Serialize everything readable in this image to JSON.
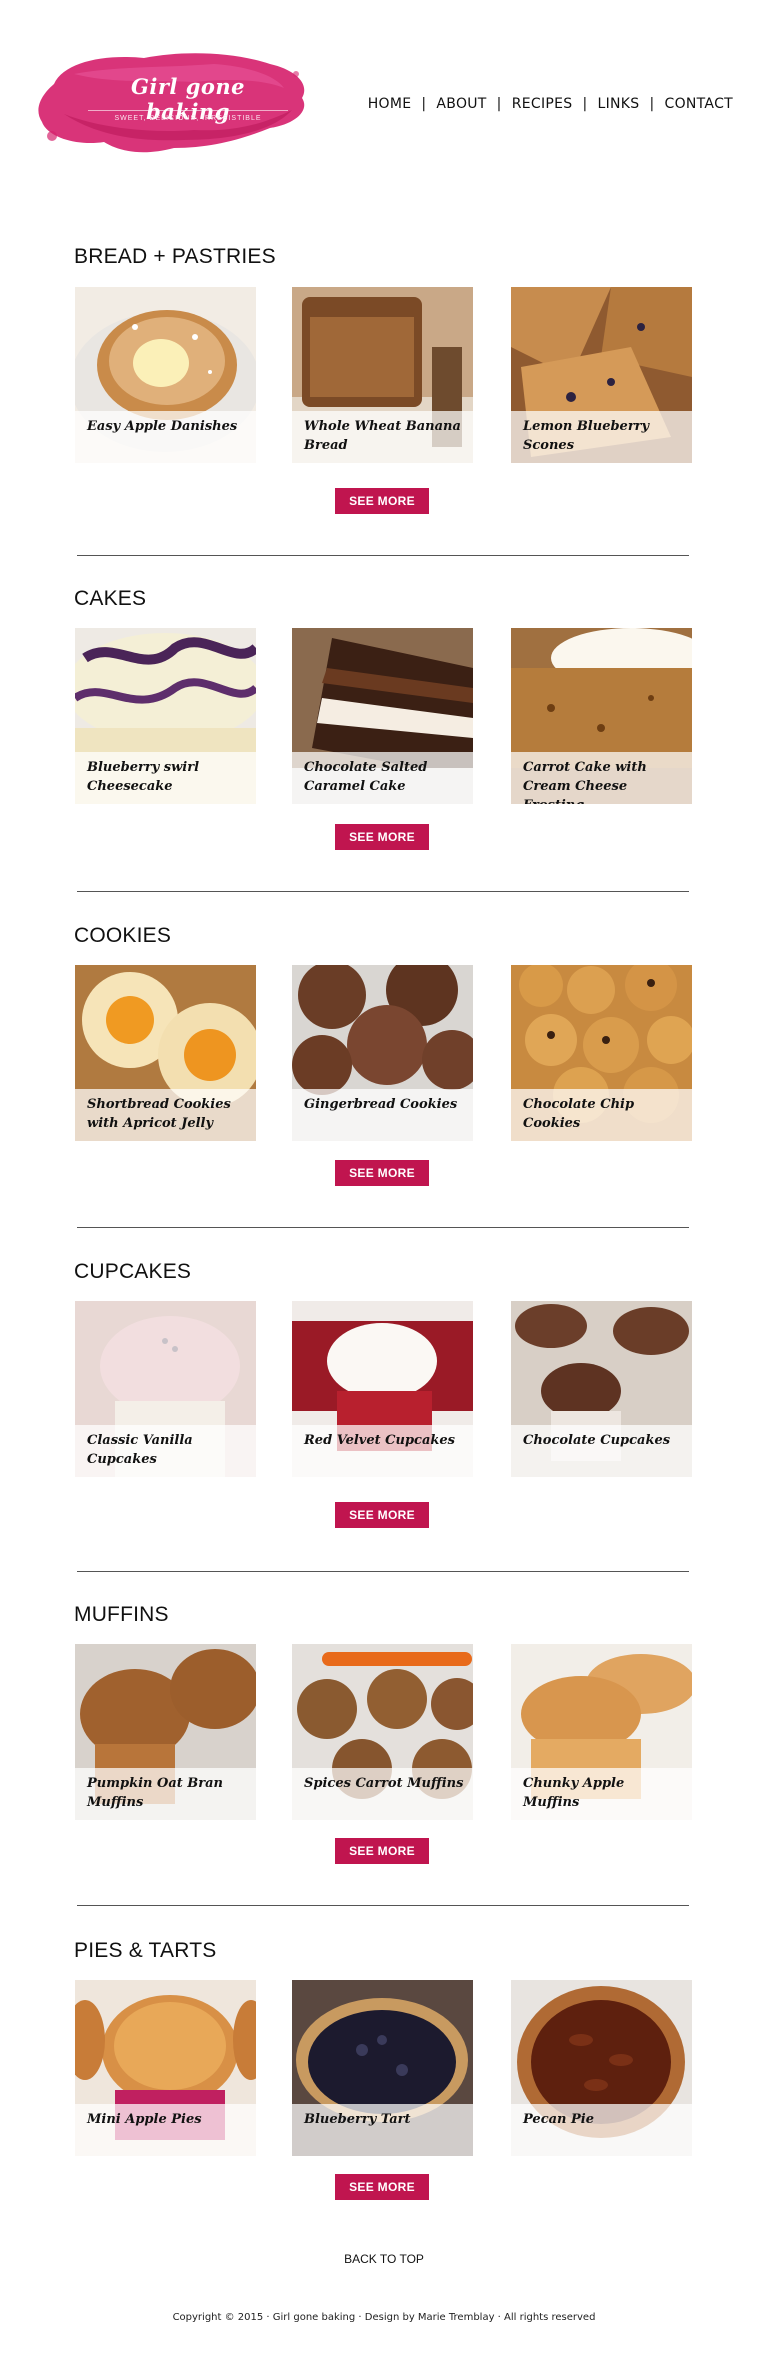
{
  "brand": {
    "title": "Girl gone baking",
    "tagline": "SWEET, DELICIOUS, IRRESISTIBLE",
    "color": "#d6236e"
  },
  "nav": {
    "items": [
      "HOME",
      "ABOUT",
      "RECIPES",
      "LINKS",
      "CONTACT"
    ],
    "separator": "|"
  },
  "accent_color": "#c0154f",
  "sections": [
    {
      "title": "BREAD + PASTRIES",
      "button": "SEE MORE",
      "items": [
        {
          "label": "Easy Apple Danishes"
        },
        {
          "label": "Whole Wheat Banana Bread"
        },
        {
          "label": "Lemon Blueberry Scones"
        }
      ]
    },
    {
      "title": "CAKES",
      "button": "SEE MORE",
      "items": [
        {
          "label": "Blueberry swirl Cheesecake"
        },
        {
          "label": "Chocolate Salted Caramel Cake"
        },
        {
          "label": "Carrot Cake with Cream Cheese Frosting"
        }
      ]
    },
    {
      "title": "COOKIES",
      "button": "SEE MORE",
      "items": [
        {
          "label": "Shortbread Cookies with Apricot Jelly"
        },
        {
          "label": "Gingerbread Cookies"
        },
        {
          "label": "Chocolate Chip Cookies"
        }
      ]
    },
    {
      "title": "CUPCAKES",
      "button": "SEE MORE",
      "items": [
        {
          "label": "Classic Vanilla Cupcakes"
        },
        {
          "label": "Red Velvet Cupcakes"
        },
        {
          "label": "Chocolate Cupcakes"
        }
      ]
    },
    {
      "title": "MUFFINS",
      "button": "SEE MORE",
      "items": [
        {
          "label": "Pumpkin Oat Bran Muffins"
        },
        {
          "label": "Spices Carrot Muffins"
        },
        {
          "label": "Chunky Apple Muffins"
        }
      ]
    },
    {
      "title": "PIES & TARTS",
      "button": "SEE MORE",
      "items": [
        {
          "label": "Mini Apple Pies"
        },
        {
          "label": "Blueberry Tart"
        },
        {
          "label": "Pecan Pie"
        }
      ]
    }
  ],
  "back_to_top": "BACK TO TOP",
  "footer": {
    "text": "Copyright © 2015 · Girl gone baking · Design by Marie Tremblay · All rights reserved"
  }
}
